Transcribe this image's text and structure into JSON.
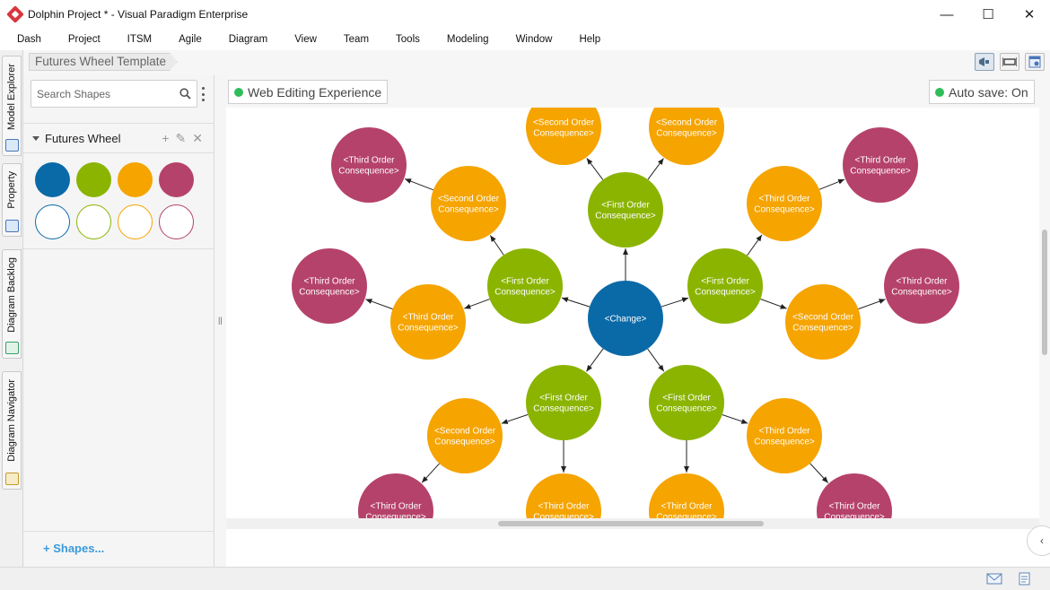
{
  "window": {
    "title": "Dolphin Project * - Visual Paradigm Enterprise",
    "controls": {
      "minimize": "—",
      "maximize": "☐",
      "close": "✕"
    }
  },
  "menu": [
    "Dash",
    "Project",
    "ITSM",
    "Agile",
    "Diagram",
    "View",
    "Team",
    "Tools",
    "Modeling",
    "Window",
    "Help"
  ],
  "side_tabs": [
    "Model Explorer",
    "Property",
    "Diagram Backlog",
    "Diagram Navigator"
  ],
  "breadcrumb": "Futures Wheel Template",
  "toolbar_icons": [
    "megaphone-icon",
    "fit-diagram-icon",
    "diagram-settings-icon"
  ],
  "shapes_panel": {
    "search_placeholder": "Search Shapes",
    "group_title": "Futures Wheel",
    "group_actions": [
      "+",
      "✎",
      "✕"
    ],
    "swatches_filled": [
      "#0a6aa8",
      "#8ab400",
      "#f5a400",
      "#b5426a"
    ],
    "swatches_outline": [
      "#0a6aa8",
      "#8ab400",
      "#f5a400",
      "#b5426a"
    ],
    "shapes_link": "+ Shapes..."
  },
  "canvas": {
    "tab_label": "Web Editing Experience",
    "autosave": "Auto save: On"
  },
  "colors": {
    "change": "#0a6aa8",
    "first": "#8ab400",
    "second": "#f5a400",
    "third": "#b5426a",
    "status_green": "#2ebd59"
  },
  "diagram": {
    "center": {
      "line1": "<Change>"
    },
    "first_order": {
      "line1": "<First Order",
      "line2": "Consequence>"
    },
    "second_order": {
      "line1": "<Second Order",
      "line2": "Consequence>"
    },
    "third_order": {
      "line1": "<Third Order",
      "line2": "Consequence>"
    }
  }
}
